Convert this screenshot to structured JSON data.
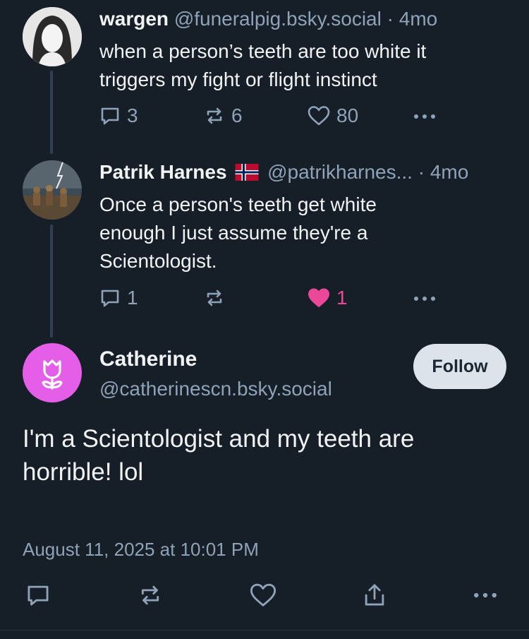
{
  "posts": [
    {
      "display_name": "wargen",
      "handle": "@funeralpig.bsky.social",
      "age": "· 4mo",
      "text_lines": [
        "when a person’s teeth are too white it",
        "triggers my fight or flight instinct"
      ],
      "replies": "3",
      "reposts": "6",
      "likes": "80",
      "liked": false
    },
    {
      "display_name": "Patrik Harnes",
      "flag_icon": "norway-flag-icon",
      "handle": "@patrikharnes...",
      "age": "· 4mo",
      "text_lines": [
        "Once a person's teeth get white",
        "enough I just assume they're a",
        "Scientologist."
      ],
      "replies": "1",
      "reposts": "",
      "likes": "1",
      "liked": true
    }
  ],
  "main_post": {
    "display_name": "Catherine",
    "handle": "@catherinescn.bsky.social",
    "follow_label": "Follow",
    "text_lines": [
      "I'm a Scientologist and my teeth are",
      "horrible! lol"
    ],
    "timestamp": "August 11, 2025 at 10:01 PM",
    "avatar_color": "#e45ee8"
  },
  "colors": {
    "background": "#161e27",
    "muted": "#8fa3b8",
    "like_active": "#ec4899",
    "thread_line": "#2e4052"
  }
}
